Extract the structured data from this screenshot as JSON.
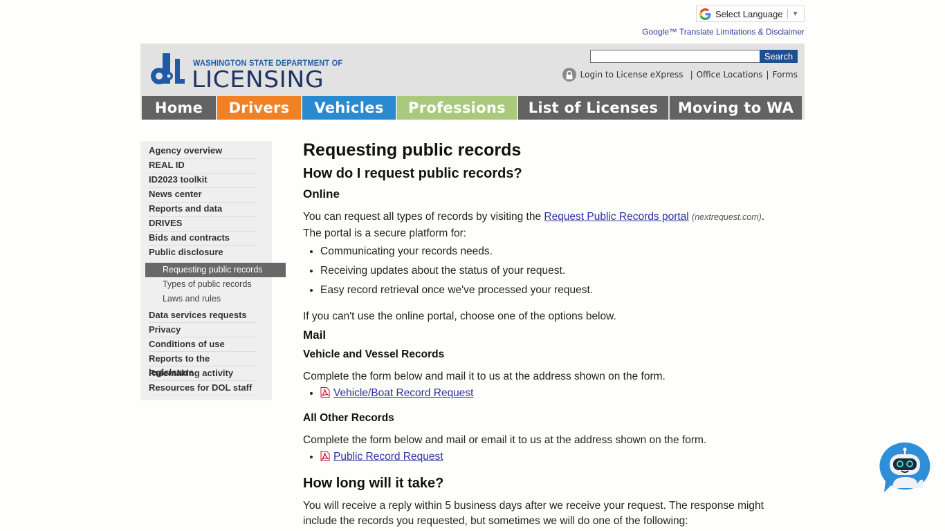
{
  "translate": {
    "label": "Select Language",
    "disclaimer": "Google™ Translate Limitations & Disclaimer"
  },
  "header": {
    "logo_sub": "WASHINGTON STATE DEPARTMENT OF",
    "logo_main": "LICENSING",
    "search_placeholder": "",
    "search_button": "Search",
    "login_link": "Login to License eXpress",
    "office_link": "Office Locations",
    "forms_link": "Forms",
    "pipe": "|"
  },
  "nav": {
    "items": [
      {
        "label": "Home",
        "color": "#636363"
      },
      {
        "label": "Drivers",
        "color": "#f08124"
      },
      {
        "label": "Vehicles",
        "color": "#2a8ad0"
      },
      {
        "label": "Professions",
        "color": "#a9c97c"
      },
      {
        "label": "List of Licenses",
        "color": "#636363"
      },
      {
        "label": "Moving to WA",
        "color": "#636363"
      }
    ]
  },
  "sidebar": {
    "items_top": [
      "Agency overview",
      "REAL ID",
      "ID2023 toolkit",
      "News center",
      "Reports and data",
      "DRIVES",
      "Bids and contracts",
      "Public disclosure"
    ],
    "sub_items": [
      {
        "label": "Requesting public records",
        "active": true
      },
      {
        "label": "Types of public records",
        "active": false
      },
      {
        "label": "Laws and rules",
        "active": false
      }
    ],
    "items_bottom": [
      "Data services requests",
      "Privacy",
      "Conditions of use",
      "Reports to the legislature",
      "Rulemaking activity",
      "Resources for DOL staff"
    ]
  },
  "main": {
    "title": "Requesting public records",
    "h2_request": "How do I request public records?",
    "h3_online": "Online",
    "online_p1_before": "You can request all types of records by visiting the ",
    "online_link": "Request Public Records portal",
    "online_note": "(nextrequest.com)",
    "online_p1_after": ".",
    "online_p2": "The portal is a secure platform for:",
    "online_bullets": [
      "Communicating your records needs.",
      "Receiving updates about the status of your request.",
      "Easy record retrieval once we've processed your request."
    ],
    "alt_options": "If you can't use the online portal, choose one of the options below.",
    "h3_mail": "Mail",
    "h4_vehicle": "Vehicle and Vessel Records",
    "vehicle_p": "Complete the form below and mail it to us at the address shown on the form.",
    "vehicle_link": "Vehicle/Boat Record Request",
    "h4_other": "All Other Records",
    "other_p": "Complete the form below and mail or email it to us at the address shown on the form.",
    "other_link": "Public Record Request",
    "h2_howlong": "How long will it take?",
    "howlong_p": "You will receive a reply within 5 business days after we receive your request. The response might include the records you requested, but sometimes we will do one of the following:"
  }
}
